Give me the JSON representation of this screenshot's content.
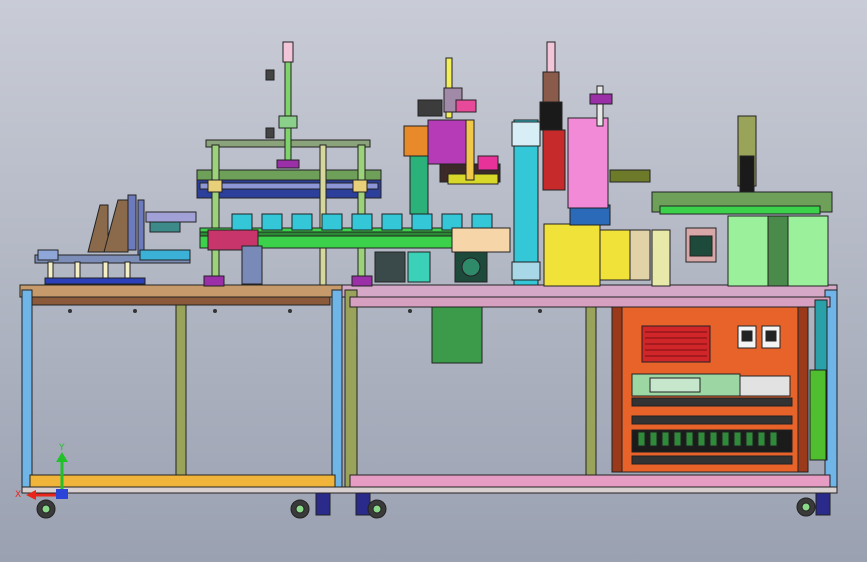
{
  "viewport": {
    "background_top": "#c9ccd6",
    "background_bottom": "#9aa1b1"
  },
  "triad": {
    "y_label": "Y",
    "x_label": "X",
    "y_color": "#22c12a",
    "x_color": "#e8261c",
    "z_color": "#2a44d8"
  },
  "colors": {
    "frame_top_rail": "#c79a6b",
    "frame_right_rail": "#d7a0c0",
    "frame_post_blue": "#6fb5e8",
    "frame_post_olive": "#9aa35a",
    "frame_bottom_left": "#f0b43a",
    "frame_bottom_right": "#e79cc3",
    "cabinet_orange": "#e8632a",
    "green_panel": "#3c9b4a",
    "conveyor_green": "#3bd14a",
    "cylinder_cyan": "#33c7d8",
    "yellow_block": "#f1e23a",
    "light_green_housing": "#9bf19b",
    "purple_accent": "#9b2fa8",
    "black": "#111111",
    "red_vent": "#d0262a"
  }
}
